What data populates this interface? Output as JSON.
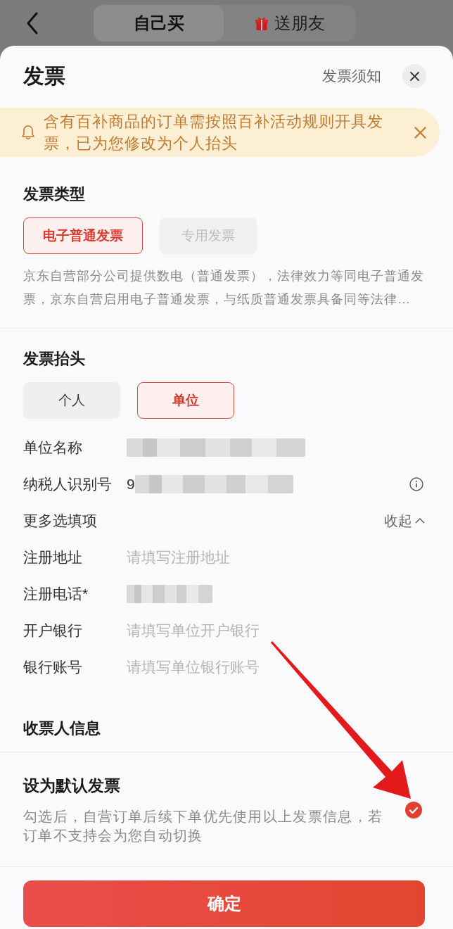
{
  "top_bar": {
    "tabs": [
      {
        "label": "自己买",
        "selected": true,
        "kind": "plain"
      },
      {
        "label": "送朋友",
        "selected": false,
        "kind": "gift"
      }
    ]
  },
  "sheet": {
    "title": "发票",
    "notice_link": "发票须知"
  },
  "banner": {
    "text": "含有百补商品的订单需按照百补活动规则开具发票，已为您修改为个人抬头"
  },
  "invoice_type": {
    "heading": "发票类型",
    "options": [
      {
        "label": "电子普通发票",
        "selected": true,
        "disabled": false
      },
      {
        "label": "专用发票",
        "selected": false,
        "disabled": true
      }
    ],
    "description": "京东自营部分公司提供数电（普通发票），法律效力等同电子普通发票，京东自营启用电子普通发票，与纸质普通发票具备同等法律…"
  },
  "invoice_title": {
    "heading": "发票抬头",
    "options": [
      {
        "label": "个人",
        "selected": false
      },
      {
        "label": "单位",
        "selected": true
      }
    ],
    "fields": [
      {
        "label": "单位名称",
        "redacted": true,
        "info": false
      },
      {
        "label": "纳税人识别号",
        "value": "9",
        "redacted": true,
        "info": true
      }
    ],
    "more_options": {
      "label": "更多选填项",
      "toggle": "收起",
      "expanded": true
    },
    "optional_fields": [
      {
        "label": "注册地址",
        "placeholder": "请填写注册地址",
        "redacted": false
      },
      {
        "label": "注册电话*",
        "redacted": true
      },
      {
        "label": "开户银行",
        "placeholder": "请填写单位开户银行",
        "redacted": false
      },
      {
        "label": "银行账号",
        "placeholder": "请填写单位银行账号",
        "redacted": false
      }
    ]
  },
  "recipient": {
    "heading": "收票人信息"
  },
  "default_invoice": {
    "heading": "设为默认发票",
    "description": "勾选后，自营订单后续下单优先使用以上发票信息，若订单不支持会为您自动切换",
    "checked": true
  },
  "confirm_button": {
    "label": "确定"
  }
}
